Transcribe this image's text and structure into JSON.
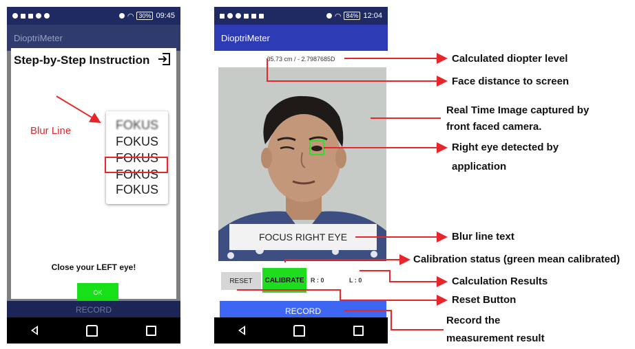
{
  "left_phone": {
    "status_time": "09:45",
    "status_battery": "30%",
    "app_title": "DioptriMeter",
    "dialog_title": "Step-by-Step Instruction",
    "blur_label": "Blur Line",
    "fokus_lines": [
      "FOKUS",
      "FOKUS",
      "FOKUS",
      "FOKUS",
      "FOKUS"
    ],
    "instruction": "Close your LEFT eye!",
    "ok_label": "OK",
    "record_label": "RECORD"
  },
  "right_phone": {
    "status_time": "12:04",
    "status_battery": "84%",
    "app_title": "DioptriMeter",
    "distance_text": "35.73 cm / - 2.7987685D",
    "focus_text": "FOCUS RIGHT EYE",
    "reset_label": "RESET",
    "calibrate_label": "CALIBRATE",
    "result_r": "R : 0",
    "result_l": "L : 0",
    "record_label": "RECORD"
  },
  "annotations": {
    "diopter": "Calculated diopter level",
    "distance": "Face distance to screen",
    "realtime_1": "Real Time Image captured by",
    "realtime_2": "front faced camera.",
    "eye_1": "Right eye detected by",
    "eye_2": "application",
    "blurline": "Blur line text",
    "calibration": "Calibration status (green mean calibrated)",
    "calculation": "Calculation Results",
    "reset": "Reset Button",
    "record_1": "Record the",
    "record_2": "measurement result"
  },
  "colors": {
    "annotation_red": "#e8262a",
    "calibrate_green": "#1fdc1f",
    "record_blue": "#3d66f2",
    "appbar_blue": "#2d3cb4"
  }
}
